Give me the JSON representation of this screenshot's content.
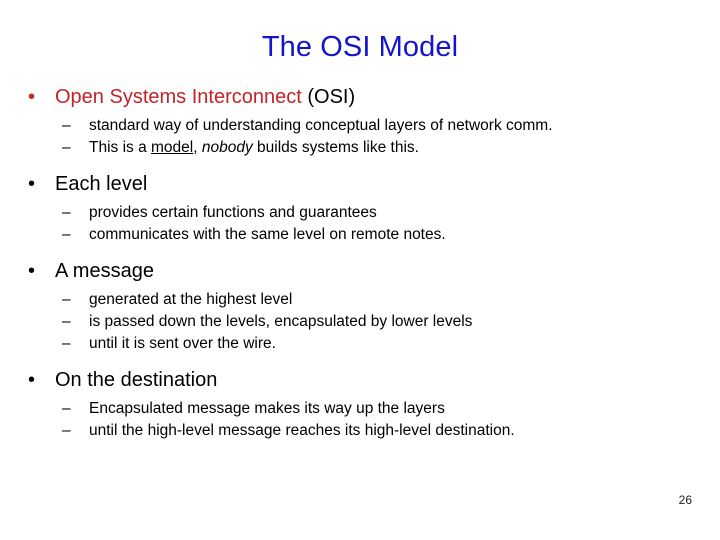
{
  "slide": {
    "title": "The OSI Model",
    "title_color": "#1414cc",
    "accent_red": "#c22328",
    "background_color": "#ffffff",
    "page_number": "26",
    "bullet_marker": "•",
    "sub_bullet_marker": "–"
  },
  "content": {
    "groups": [
      {
        "heading": "Open Systems Interconnect",
        "heading_tail": " (OSI)",
        "heading_color": "#c22328",
        "items": [
          {
            "text": "standard way of understanding conceptual layers of network comm.",
            "runs": [
              {
                "text": "standard way of understanding conceptual layers of network comm.",
                "style": "plain"
              }
            ]
          },
          {
            "text": "This is a model, nobody builds systems like this.",
            "runs": [
              {
                "text": "This is a ",
                "style": "plain"
              },
              {
                "text": "model",
                "style": "underline"
              },
              {
                "text": ", ",
                "style": "plain"
              },
              {
                "text": "nobody",
                "style": "italic"
              },
              {
                "text": " builds systems like this.",
                "style": "plain"
              }
            ]
          }
        ]
      },
      {
        "heading": "Each level",
        "heading_tail": "",
        "heading_color": "#000000",
        "items": [
          {
            "text": "provides certain functions and guarantees",
            "runs": [
              {
                "text": "provides certain functions and guarantees",
                "style": "plain"
              }
            ]
          },
          {
            "text": "communicates with the same level on remote notes.",
            "runs": [
              {
                "text": "communicates with the same level on remote notes.",
                "style": "plain"
              }
            ]
          }
        ]
      },
      {
        "heading": "A message",
        "heading_tail": "",
        "heading_color": "#000000",
        "items": [
          {
            "text": "generated at the highest level",
            "runs": [
              {
                "text": "generated at the highest level",
                "style": "plain"
              }
            ]
          },
          {
            "text": "is passed down the levels, encapsulated by lower levels",
            "runs": [
              {
                "text": "is passed down the levels, encapsulated by lower levels",
                "style": "plain"
              }
            ]
          },
          {
            "text": "until it is sent over the wire.",
            "runs": [
              {
                "text": "until it is sent over the wire.",
                "style": "plain"
              }
            ]
          }
        ]
      },
      {
        "heading": "On the destination",
        "heading_tail": "",
        "heading_color": "#000000",
        "items": [
          {
            "text": "Encapsulated message makes its way up the layers",
            "runs": [
              {
                "text": "Encapsulated message makes its way up the layers",
                "style": "plain"
              }
            ]
          },
          {
            "text": "until the high-level message reaches its high-level destination.",
            "runs": [
              {
                "text": "until the high-level message reaches its high-level destination.",
                "style": "plain"
              }
            ]
          }
        ]
      }
    ]
  }
}
